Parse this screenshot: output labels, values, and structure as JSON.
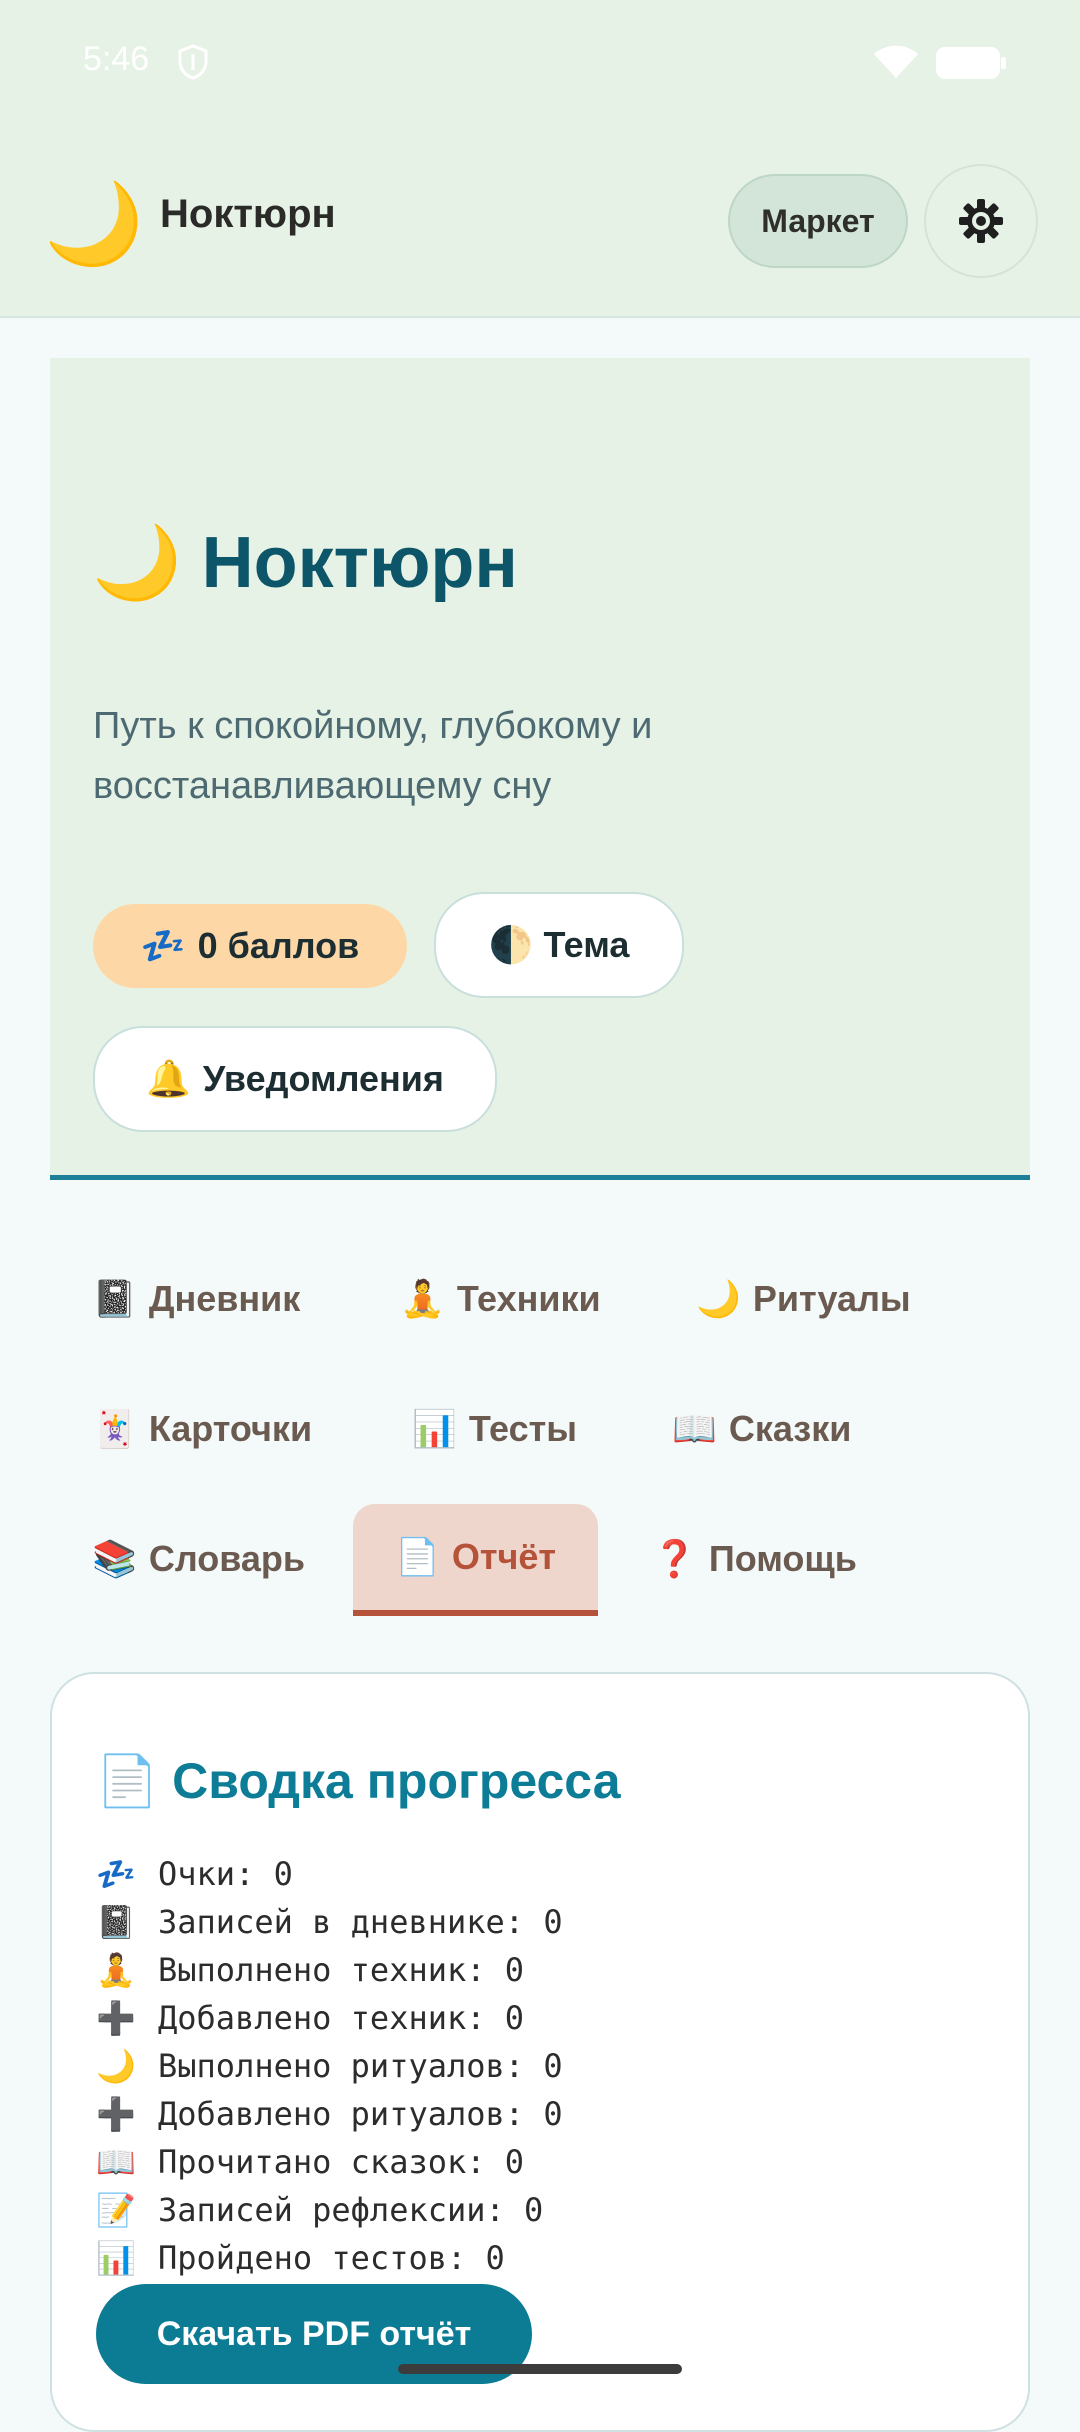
{
  "status_bar": {
    "time": "5:46",
    "icons": [
      "shield-icon",
      "wifi-icon",
      "battery-icon"
    ]
  },
  "app_bar": {
    "logo_glyph": "🌙",
    "title": "Ноктюрн",
    "market_label": "Маркет",
    "settings_icon": "gear-icon"
  },
  "hero": {
    "title_glyph": "🌙",
    "title": "Ноктюрн",
    "subtitle": "Путь к спокойному, глубокому и восстанавливающему сну",
    "points_glyph": "💤",
    "points_label": "0 баллов",
    "theme_glyph": "🌓",
    "theme_label": "Тема",
    "notify_glyph": "🔔",
    "notify_label": "Уведомления"
  },
  "tabs": [
    {
      "glyph": "📓",
      "label": "Дневник"
    },
    {
      "glyph": "🧘",
      "label": "Техники"
    },
    {
      "glyph": "🌙",
      "label": "Ритуалы"
    },
    {
      "glyph": "🃏",
      "label": "Карточки"
    },
    {
      "glyph": "📊",
      "label": "Тесты"
    },
    {
      "glyph": "📖",
      "label": "Сказки"
    },
    {
      "glyph": "📚",
      "label": "Словарь"
    },
    {
      "glyph": "📄",
      "label": "Отчёт"
    },
    {
      "glyph": "❓",
      "label": "Помощь"
    }
  ],
  "active_tab": "Отчёт",
  "report": {
    "title_glyph": "📄",
    "title": "Сводка прогресса",
    "stats": [
      {
        "glyph": "💤",
        "text": "Очки: 0"
      },
      {
        "glyph": "📓",
        "text": "Записей в дневнике: 0"
      },
      {
        "glyph": "🧘",
        "text": "Выполнено техник: 0"
      },
      {
        "glyph": "➕",
        "text": "Добавлено техник: 0"
      },
      {
        "glyph": "🌙",
        "text": "Выполнено ритуалов: 0"
      },
      {
        "glyph": "➕",
        "text": "Добавлено ритуалов: 0"
      },
      {
        "glyph": "📖",
        "text": "Прочитано сказок: 0"
      },
      {
        "glyph": "📝",
        "text": "Записей рефлексии: 0"
      },
      {
        "glyph": "📊",
        "text": "Пройдено тестов: 0"
      }
    ],
    "pdf_button_label": "Скачать PDF отчёт"
  },
  "colors": {
    "header_bg": "#e7f2e6",
    "accent_teal": "#0c7b94",
    "active_tab": "#b4533a",
    "points_chip": "#fdd8a6"
  }
}
